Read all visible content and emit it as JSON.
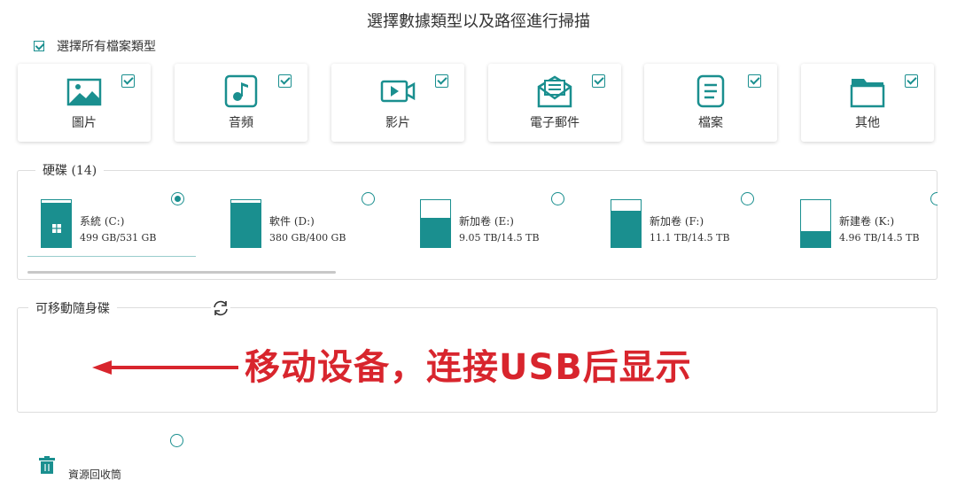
{
  "title": "選擇數據類型以及路徑進行掃描",
  "select_all": {
    "label": "選擇所有檔案類型",
    "checked": true
  },
  "file_types": [
    {
      "label": "圖片",
      "icon": "image-icon",
      "checked": true
    },
    {
      "label": "音頻",
      "icon": "music-icon",
      "checked": true
    },
    {
      "label": "影片",
      "icon": "video-icon",
      "checked": true
    },
    {
      "label": "電子郵件",
      "icon": "email-icon",
      "checked": true
    },
    {
      "label": "檔案",
      "icon": "document-icon",
      "checked": true
    },
    {
      "label": "其他",
      "icon": "folder-icon",
      "checked": true
    }
  ],
  "hard_disks": {
    "legend": "硬碟 (14)",
    "drives": [
      {
        "name": "系統 (C:)",
        "size": "499 GB/531 GB",
        "used_fraction": 0.94,
        "selected": true,
        "system": true
      },
      {
        "name": "軟件 (D:)",
        "size": "380 GB/400 GB",
        "used_fraction": 0.95,
        "selected": false
      },
      {
        "name": "新加卷 (E:)",
        "size": "9.05 TB/14.5 TB",
        "used_fraction": 0.62,
        "selected": false
      },
      {
        "name": "新加卷 (F:)",
        "size": "11.1 TB/14.5 TB",
        "used_fraction": 0.77,
        "selected": false
      },
      {
        "name": "新建卷 (K:)",
        "size": "4.96 TB/14.5 TB",
        "used_fraction": 0.34,
        "selected": false
      }
    ]
  },
  "removable": {
    "legend": "可移動隨身碟",
    "annotation": "移动设备，连接USB后显示"
  },
  "recycle_bin": {
    "label": "資源回收筒",
    "selected": false
  },
  "colors": {
    "accent": "#1a8f8f",
    "annotation": "#d8252d"
  }
}
